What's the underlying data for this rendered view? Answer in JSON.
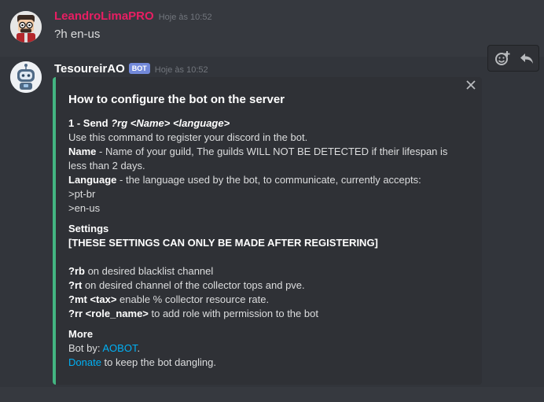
{
  "messages": [
    {
      "username": "LeandroLimaPRO",
      "timestamp": "Hoje às 10:52",
      "content": "?h en-us",
      "avatar": "funko-avatar"
    },
    {
      "username": "TesoureirAO",
      "badge": "BOT",
      "timestamp": "Hoje às 10:52",
      "avatar": "robot-avatar",
      "embed": {
        "accent_color": "#43b581",
        "title": "How to configure the bot on the server",
        "section1": {
          "step_label": "1 - Send ",
          "command": "?rg <Name> <language>",
          "line1": "Use this command to register your discord in the bot.",
          "name_label": "Name",
          "name_text": " - Name of your guild, The guilds WILL NOT BE DETECTED if their lifespan is",
          "name_text2": "less than 2 days.",
          "lang_label": "Language",
          "lang_text": " - the language used by the bot, to communicate, currently accepts:",
          "opt1": ">pt-br",
          "opt2": ">en-us"
        },
        "settings": {
          "heading": "Settings",
          "warning": "[THESE SETTINGS CAN ONLY BE MADE AFTER REGISTERING]",
          "rb_cmd": "?rb",
          "rb_text": " on desired blacklist channel",
          "rt_cmd": "?rt",
          "rt_text": " on desired channel of the collector tops and pve.",
          "mt_cmd": "?mt <tax>",
          "mt_text": " enable % collector resource rate.",
          "rr_cmd": "?rr <role_name>",
          "rr_text": " to add role with permission to the bot"
        },
        "more": {
          "heading": "More",
          "by_label": "Bot by: ",
          "by_link": "AOBOT",
          "by_suffix": ".",
          "donate_link": "Donate",
          "donate_text": " to keep the bot dangling."
        }
      }
    }
  ],
  "toolbar": {
    "icons": [
      "add-reaction-icon",
      "reply-icon"
    ]
  },
  "colors": {
    "background": "#36393f",
    "embed_bg": "#2f3136",
    "username_1": "#e91e63",
    "link": "#00b0f4",
    "bot_badge": "#7289da"
  }
}
